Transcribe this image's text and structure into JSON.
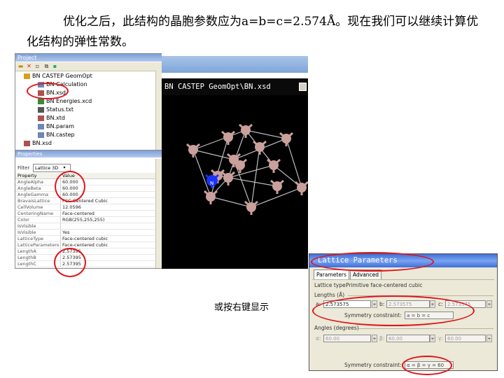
{
  "caption": "优化之后，此结构的晶胞参数应为a=b=c=2.574Å。现在我们可以继续计算优化结构的弹性常数。",
  "project": {
    "title": "Project",
    "toolbar": [
      "folder-icon",
      "close-icon",
      "new-icon",
      "copy-icon",
      "save-icon"
    ],
    "tree": [
      {
        "label": "BN CASTEP GeomOpt",
        "icon": "folder-icon",
        "depth": 0
      },
      {
        "label": "BN Calculation",
        "icon": "file-icon",
        "depth": 1
      },
      {
        "label": "BN.xsd",
        "icon": "structure-icon",
        "depth": 1
      },
      {
        "label": "BN Energies.xcd",
        "icon": "chart-icon",
        "depth": 1
      },
      {
        "label": "Status.txt",
        "icon": "text-icon",
        "depth": 1
      },
      {
        "label": "BN.xtd",
        "icon": "structure-icon",
        "depth": 1
      },
      {
        "label": "BN.param",
        "icon": "file-icon",
        "depth": 1
      },
      {
        "label": "BN.castep",
        "icon": "file-icon",
        "depth": 1
      },
      {
        "label": "BN.xsd",
        "icon": "structure-icon",
        "depth": 0
      }
    ]
  },
  "properties": {
    "title": "Properties",
    "filter_label": "Filter",
    "filter_value": "Lattice 3D",
    "col_property": "Property",
    "col_value": "Value",
    "rows": [
      {
        "name": "AngleAlpha",
        "value": "60.000"
      },
      {
        "name": "AngleBeta",
        "value": "60.000"
      },
      {
        "name": "AngleGamma",
        "value": "60.000"
      },
      {
        "name": "BravaisLattice",
        "value": "FCC Centered Cubic"
      },
      {
        "name": "CellVolume",
        "value": "12.0596"
      },
      {
        "name": "CenteringName",
        "value": "Face-centered"
      },
      {
        "name": "Color",
        "value": "RGB(255,255,255)"
      },
      {
        "name": "IsVisible",
        "value": ""
      },
      {
        "name": "IsVisible",
        "value": "Yes"
      },
      {
        "name": "LatticeType",
        "value": "Face-centered cubic"
      },
      {
        "name": "LatticeParameters",
        "value": "Face-centered cubic"
      },
      {
        "name": "LengthA",
        "value": "2.57395"
      },
      {
        "name": "LengthB",
        "value": "2.57395"
      },
      {
        "name": "LengthC",
        "value": "2.57395"
      }
    ]
  },
  "viewer": {
    "title": "BN CASTEP GeomOpt\\BN.xsd",
    "atom_label": "N"
  },
  "mid_caption": "或按右键显示",
  "dialog": {
    "title": "Lattice Parameters",
    "tabs": [
      "Parameters",
      "Advanced"
    ],
    "lattice_type_label": "Lattice type:",
    "lattice_type_value": "Primitive face-centered cubic",
    "lengths_label": "Lengths (Å)",
    "a_label": "a:",
    "a_value": "2.573575",
    "b_label": "b:",
    "b_value": "2.573575",
    "c_label": "c:",
    "c_value": "2.573575",
    "length_constraint_label": "Symmetry constraint:",
    "length_constraint_value": "a = b = c",
    "angles_label": "Angles (degrees)",
    "alpha_label": "α:",
    "alpha_value": "60.00",
    "beta_label": "β:",
    "beta_value": "60.00",
    "gamma_label": "γ:",
    "gamma_value": "60.00",
    "angle_constraint_label": "Symmetry constraint:",
    "angle_constraint_value": "α = β = γ = 60"
  },
  "colors": {
    "highlight": "#e0141c",
    "boron_atom": "#c9a09c",
    "nitrogen_atom": "#1a33ff",
    "viewer_bg": "#000000"
  }
}
